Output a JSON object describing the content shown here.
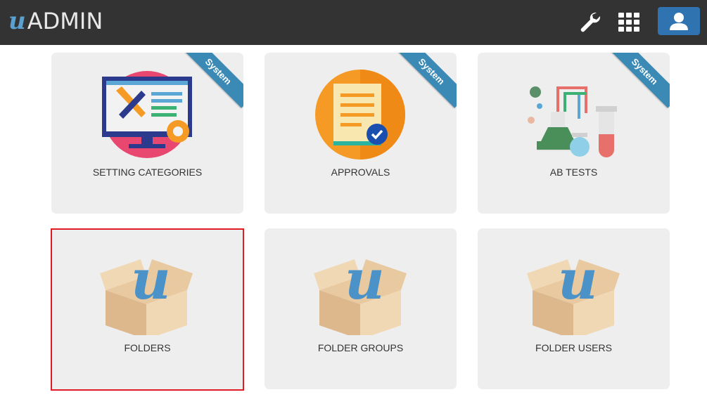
{
  "header": {
    "logo_u": "u",
    "logo_text": "ADMIN"
  },
  "colors": {
    "topbar": "#333333",
    "accent": "#2f73b0",
    "card_bg": "#eeeeee",
    "selected_border": "#e01b24",
    "ribbon": "#3a8ab5"
  },
  "cards": [
    {
      "label": "SETTING CATEGORIES",
      "ribbon": "System",
      "icon": "monitor-tools-icon"
    },
    {
      "label": "APPROVALS",
      "ribbon": "System",
      "icon": "approval-document-icon"
    },
    {
      "label": "AB TESTS",
      "ribbon": "System",
      "icon": "lab-flasks-icon"
    },
    {
      "label": "FOLDERS",
      "icon": "folder-box-icon",
      "selected": true
    },
    {
      "label": "FOLDER GROUPS",
      "icon": "folder-box-icon"
    },
    {
      "label": "FOLDER USERS",
      "icon": "folder-box-icon"
    }
  ]
}
